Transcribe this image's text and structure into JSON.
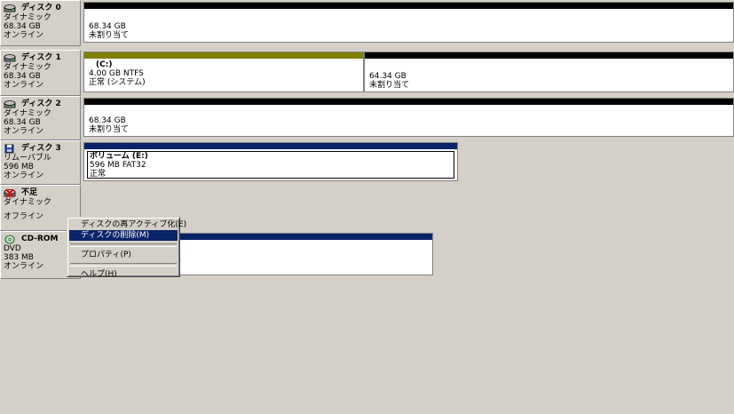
{
  "disks": [
    {
      "title": "ディスク 0",
      "icon": "disk-icon",
      "lines": [
        "ダイナミック",
        "68.34 GB",
        "オンライン"
      ],
      "partitions": [
        {
          "bar": "black",
          "name": "",
          "size": "68.34 GB",
          "status": "未割り当て"
        }
      ]
    },
    {
      "title": "ディスク 1",
      "icon": "disk-icon",
      "lines": [
        "ダイナミック",
        "68.34 GB",
        "オンライン"
      ],
      "partitions": [
        {
          "bar": "olive",
          "name": "(C:)",
          "size": "4.00 GB NTFS",
          "status": "正常 (システム)"
        },
        {
          "bar": "black",
          "name": "",
          "size": "64.34 GB",
          "status": "未割り当て"
        }
      ]
    },
    {
      "title": "ディスク 2",
      "icon": "disk-icon",
      "lines": [
        "ダイナミック",
        "68.34 GB",
        "オンライン"
      ],
      "partitions": [
        {
          "bar": "black",
          "name": "",
          "size": "68.34 GB",
          "status": "未割り当て"
        }
      ]
    },
    {
      "title": "ディスク 3",
      "icon": "removable-disk-icon",
      "lines": [
        "リムーバブル",
        "596 MB",
        "オンライン"
      ],
      "partitions": [
        {
          "bar": "navy",
          "name": "ボリューム (E:)",
          "size": "596 MB FAT32",
          "status": "正常"
        }
      ]
    },
    {
      "title": "不足",
      "icon": "missing-disk-icon",
      "lines": [
        "ダイナミック",
        "",
        "オフライン"
      ],
      "partitions": []
    },
    {
      "title": "CD-ROM",
      "icon": "cdrom-icon",
      "lines": [
        "DVD",
        "383 MB",
        "オンライン"
      ],
      "partitions": [
        {
          "bar": "navy",
          "name": "",
          "size": "",
          "status": ""
        }
      ]
    }
  ],
  "context_menu": {
    "items": [
      {
        "label": "ディスクの再アクティブ化(E)",
        "highlighted": false
      },
      {
        "label": "ディスクの削除(M)",
        "highlighted": true
      },
      {
        "label": "プロパティ(P)",
        "highlighted": false
      },
      {
        "label": "ヘルプ(H)",
        "highlighted": false
      }
    ]
  },
  "colors": {
    "unallocated": "#000000",
    "primary": "#808000",
    "simple_volume": "#0a246a",
    "background": "#d4d0c8"
  }
}
